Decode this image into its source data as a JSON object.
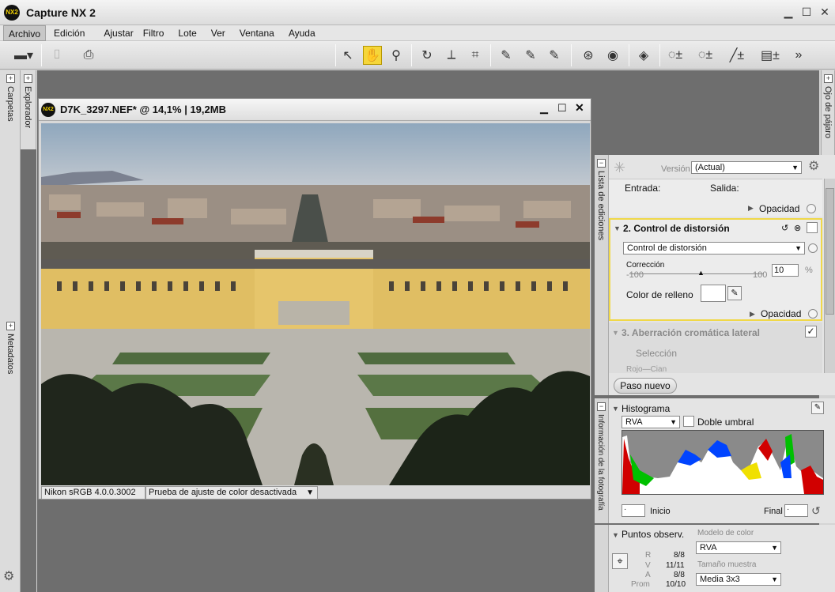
{
  "app": {
    "title": "Capture NX 2",
    "logo_text": "NX2"
  },
  "menu": [
    "Archivo",
    "Edición",
    "Ajustar",
    "Filtro",
    "Lote",
    "Ver",
    "Ventana",
    "Ayuda"
  ],
  "side_left": {
    "carpetas": "Carpetas",
    "explorador": "Explorador",
    "metadatos": "Metadatos"
  },
  "side_right": {
    "ojo": "Ojo de pájaro"
  },
  "image_window": {
    "title": "D7K_3297.NEF* @ 14,1% | 19,2MB",
    "status_profile": "Nikon sRGB 4.0.0.3002",
    "status_proof": "Prueba de ajuste de color desactivada"
  },
  "edit_list": {
    "strip_label": "Lista de ediciones",
    "version_label": "Versión",
    "version_value": "(Actual)",
    "entrada": "Entrada:",
    "salida": "Salida:",
    "opacidad": "Opacidad",
    "step2_title": "2. Control de distorsión",
    "step2_dropdown": "Control de distorsión",
    "correccion_label": "Corrección",
    "correccion_min": "-100",
    "correccion_max": "100",
    "correccion_value": "10",
    "correccion_unit": "%",
    "color_relleno": "Color de relleno",
    "step3_title": "3. Aberración cromática lateral",
    "seleccion": "Selección",
    "rojo_cian": "Rojo—Cian",
    "new_step": "Paso nuevo"
  },
  "histogram": {
    "strip_label": "Información de la fotografía",
    "title": "Histograma",
    "channel": "RVA",
    "double_threshold": "Doble umbral",
    "inicio_label": "Inicio",
    "final_label": "Final",
    "inicio_value": "·",
    "final_value": "·"
  },
  "watch_points": {
    "title": "Puntos observ.",
    "modelo_label": "Modelo de color",
    "modelo_value": "RVA",
    "tamano_label": "Tamaño muestra",
    "tamano_value": "Media 3x3",
    "rows": [
      {
        "label": "R",
        "value": "8/8"
      },
      {
        "label": "V",
        "value": "11/11"
      },
      {
        "label": "A",
        "value": "8/8"
      },
      {
        "label": "Prom",
        "value": "10/10"
      }
    ]
  }
}
